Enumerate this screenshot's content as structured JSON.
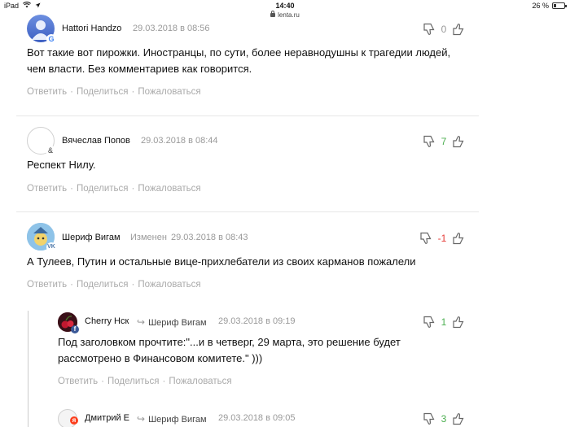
{
  "statusbar": {
    "device": "iPad",
    "time": "14:40",
    "url": "lenta.ru",
    "battery": "26 %",
    "battery_level": 0.26
  },
  "comments": [
    {
      "author": "Hattori Handzo",
      "date": "29.03.2018 в 08:56",
      "text": "Вот такие вот пирожки. Иностранцы, по сути, более неравнодушны к трагедии людей, чем власти. Без комментариев как говорится.",
      "votes": "0",
      "vote_color": "#999999",
      "badge": "G"
    },
    {
      "author": "Вячеслав Попов",
      "date": "29.03.2018 в 08:44",
      "text": "Респект Нилу.",
      "votes": "7",
      "vote_color": "#4caf50",
      "badge": "&"
    },
    {
      "author": "Шериф Вигам",
      "edited": "Изменен",
      "date": "29.03.2018 в 08:43",
      "text": "А Тулеев, Путин и остальные вице-прихлебатели из своих карманов пожалели",
      "votes": "-1",
      "vote_color": "#e53935",
      "badge": "VK"
    }
  ],
  "replies": [
    {
      "author": "Cherry Нск",
      "reply_to": "Шериф Вигам",
      "date": "29.03.2018 в 09:19",
      "text_line1": "Под заголовком прочтите:\"...и в четверг, 29 марта, это решение будет",
      "text_line2": "рассмотрено в Финансовом комитете.\" )))",
      "votes": "1",
      "vote_color": "#4caf50",
      "badge": "f"
    },
    {
      "author": "Дмитрий Е",
      "reply_to": "Шериф Вигам",
      "date": "29.03.2018 в 09:05",
      "votes": "3",
      "vote_color": "#4caf50",
      "badge": "я"
    }
  ],
  "actions": {
    "reply": "Ответить",
    "share": "Поделиться",
    "report": "Пожаловаться",
    "sep": "·"
  }
}
